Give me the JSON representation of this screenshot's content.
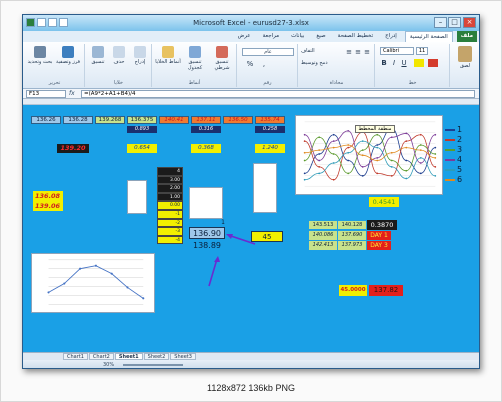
{
  "window": {
    "title": "Microsoft Excel - eurusd27-3.xlsx"
  },
  "ribbon": {
    "tabs": [
      "ملف",
      "الصفحة الرئيسية",
      "إدراج",
      "تخطيط الصفحة",
      "صيغ",
      "بيانات",
      "مراجعة",
      "عرض"
    ],
    "font_name": "Calibri",
    "font_size": "11",
    "groups": [
      {
        "label": "خط"
      },
      {
        "label": "محاذاة"
      },
      {
        "label": "رقم"
      },
      {
        "label": "أنماط"
      },
      {
        "label": "خلايا"
      },
      {
        "label": "تحرير"
      }
    ],
    "buttons": {
      "paste": "لصق",
      "wrap": "التفاف",
      "merge": "دمج وتوسيط",
      "number_format": "عام",
      "cond_format": "تنسيق شرطي",
      "format_table": "تنسيق كجدول",
      "cell_styles": "أنماط الخلايا",
      "insert": "إدراج",
      "delete": "حذف",
      "format": "تنسيق",
      "sort": "فرز وتصفية",
      "find": "بحث وتحديد"
    }
  },
  "formula_bar": {
    "name_box": "F13",
    "fx": "fx",
    "formula": "=(A9*2+A1+B4)/4"
  },
  "cells": {
    "r1": [
      "136.26",
      "136.28",
      "139.268",
      "136.375",
      "140.41",
      "137.11",
      "136.50",
      "135.74"
    ],
    "r2": [
      "0.893",
      "0.316",
      "0.258"
    ],
    "r3_red": "139.20",
    "r3": [
      "0.654",
      "0.368",
      "1.240"
    ],
    "left_yellow": [
      "136.08",
      "139.06"
    ],
    "small_col": [
      "4",
      "3.00",
      "2.00",
      "1.00",
      "0.00",
      "-1",
      "-2",
      "-3",
      "-4"
    ],
    "main1": "136.90",
    "main2": "138.89",
    "one": "1",
    "forty_five": "45",
    "row_a": [
      "143.513",
      "140.128"
    ],
    "val_a": "0.3870",
    "val_b": "0.4541",
    "row_b": [
      "140.086",
      "137.690"
    ],
    "row_c": [
      "142.413",
      "137.973"
    ],
    "day_a": "DAY 1",
    "day_b": "DAY 3",
    "bottom_pair": [
      "45.0000",
      "137.82"
    ]
  },
  "legend": {
    "title": "منطقة المخطط",
    "items": [
      "1",
      "2",
      "3",
      "4",
      "5",
      "6"
    ]
  },
  "sheets": [
    "Chart1",
    "Chart2",
    "Sheet1",
    "Sheet2",
    "Sheet3"
  ],
  "active_sheet": 2,
  "status": {
    "zoom": "30%"
  },
  "caption": "1128x872  136kb  PNG",
  "chart_data": [
    {
      "type": "line",
      "title": "",
      "x": [
        1,
        2,
        3,
        4,
        5,
        6,
        7
      ],
      "series": [
        {
          "values": [
            1.2,
            2.1,
            3.6,
            3.9,
            3.1,
            1.7,
            0.6
          ]
        }
      ],
      "ylim": [
        0,
        4.5
      ],
      "grid": true,
      "legend": "none"
    },
    {
      "type": "line",
      "title": "",
      "x": [
        1,
        2,
        3,
        4,
        5,
        6,
        7,
        8,
        9,
        10
      ],
      "series": [
        {
          "name": "1",
          "values": [
            1.0,
            2.5,
            4.0,
            2.0,
            0.8,
            3.2,
            4.5,
            2.0,
            1.0,
            3.0
          ]
        },
        {
          "name": "2",
          "values": [
            3.5,
            1.5,
            0.5,
            3.0,
            4.2,
            1.0,
            0.8,
            3.5,
            4.0,
            1.5
          ]
        },
        {
          "name": "3",
          "values": [
            2.0,
            3.8,
            2.5,
            1.0,
            2.8,
            4.0,
            2.0,
            1.2,
            3.2,
            2.5
          ]
        },
        {
          "name": "4",
          "values": [
            4.0,
            2.0,
            3.5,
            4.3,
            1.5,
            2.2,
            3.8,
            4.1,
            1.8,
            4.0
          ]
        },
        {
          "name": "5",
          "values": [
            0.5,
            1.0,
            1.8,
            2.6,
            3.5,
            3.0,
            1.5,
            0.6,
            2.2,
            0.8
          ]
        },
        {
          "name": "6",
          "values": [
            2.6,
            2.8,
            3.0,
            3.2,
            2.4,
            2.0,
            2.6,
            3.0,
            2.8,
            2.2
          ]
        }
      ],
      "grid": true,
      "legend": "right"
    }
  ]
}
